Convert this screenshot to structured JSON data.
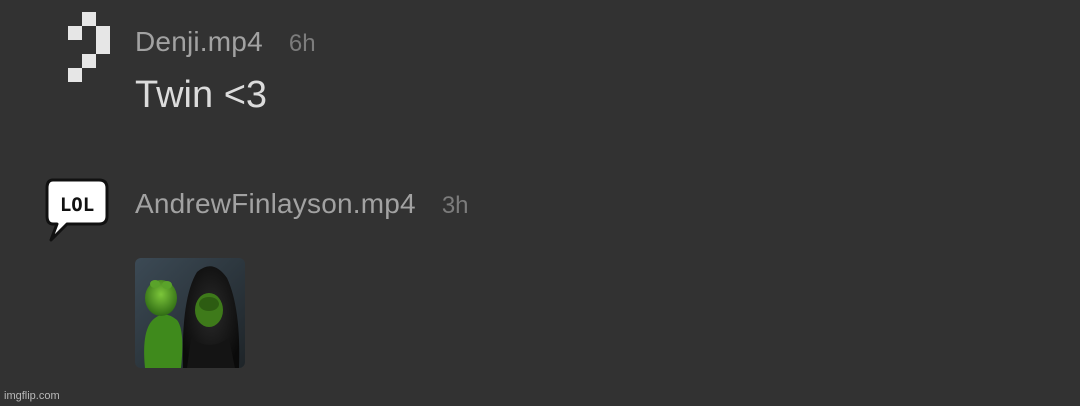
{
  "comments": [
    {
      "username": "Denji.mp4",
      "time": "6h",
      "text": "Twin <3",
      "avatar_icon": "pixel-question-mark-icon"
    },
    {
      "username": "AndrewFinlayson.mp4",
      "time": "3h",
      "avatar_icon": "lol-speech-bubble-icon",
      "avatar_text": "LOL",
      "image_icon": "evil-kermit-meme-image"
    }
  ],
  "watermark": "imgflip.com",
  "colors": {
    "background": "#323232",
    "username": "#a2a2a2",
    "timestamp": "#7c7c7c",
    "body_text": "#dcdcdc"
  }
}
